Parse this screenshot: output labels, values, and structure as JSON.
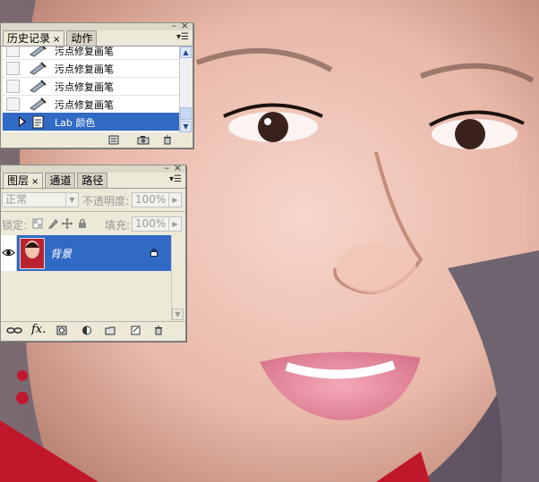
{
  "history_panel": {
    "tabs": [
      {
        "label": "历史记录",
        "active": true,
        "close": "×"
      },
      {
        "label": "动作",
        "active": false
      }
    ],
    "menu_icon": "panel-menu-icon",
    "items": [
      {
        "label": "污点修复画笔",
        "icon": "healing-brush-icon"
      },
      {
        "label": "污点修复画笔",
        "icon": "healing-brush-icon"
      },
      {
        "label": "污点修复画笔",
        "icon": "healing-brush-icon"
      },
      {
        "label": "污点修复画笔",
        "icon": "healing-brush-icon"
      },
      {
        "label": "Lab 颜色",
        "icon": "lab-color-icon",
        "selected": true
      }
    ],
    "footer_icons": [
      "new-document-from-state-icon",
      "snapshot-icon",
      "trash-icon"
    ]
  },
  "layers_panel": {
    "tabs": [
      {
        "label": "图层",
        "active": true,
        "close": "×"
      },
      {
        "label": "通道",
        "active": false
      },
      {
        "label": "路径",
        "active": false
      }
    ],
    "blend_mode": "正常",
    "opacity_label": "不透明度:",
    "opacity_value": "100%",
    "lock_label": "锁定:",
    "fill_label": "填充:",
    "fill_value": "100%",
    "layers": [
      {
        "name": "背景",
        "visible": true,
        "locked": true,
        "selected": true
      }
    ],
    "footer_icons": [
      "link-icon",
      "fx-icon",
      "mask-icon",
      "adjustment-icon",
      "folder-icon",
      "new-layer-icon",
      "trash-icon"
    ],
    "fx_label": "fx."
  },
  "colors": {
    "panel_bg": "#ece9d8",
    "selection": "#316ac5"
  }
}
